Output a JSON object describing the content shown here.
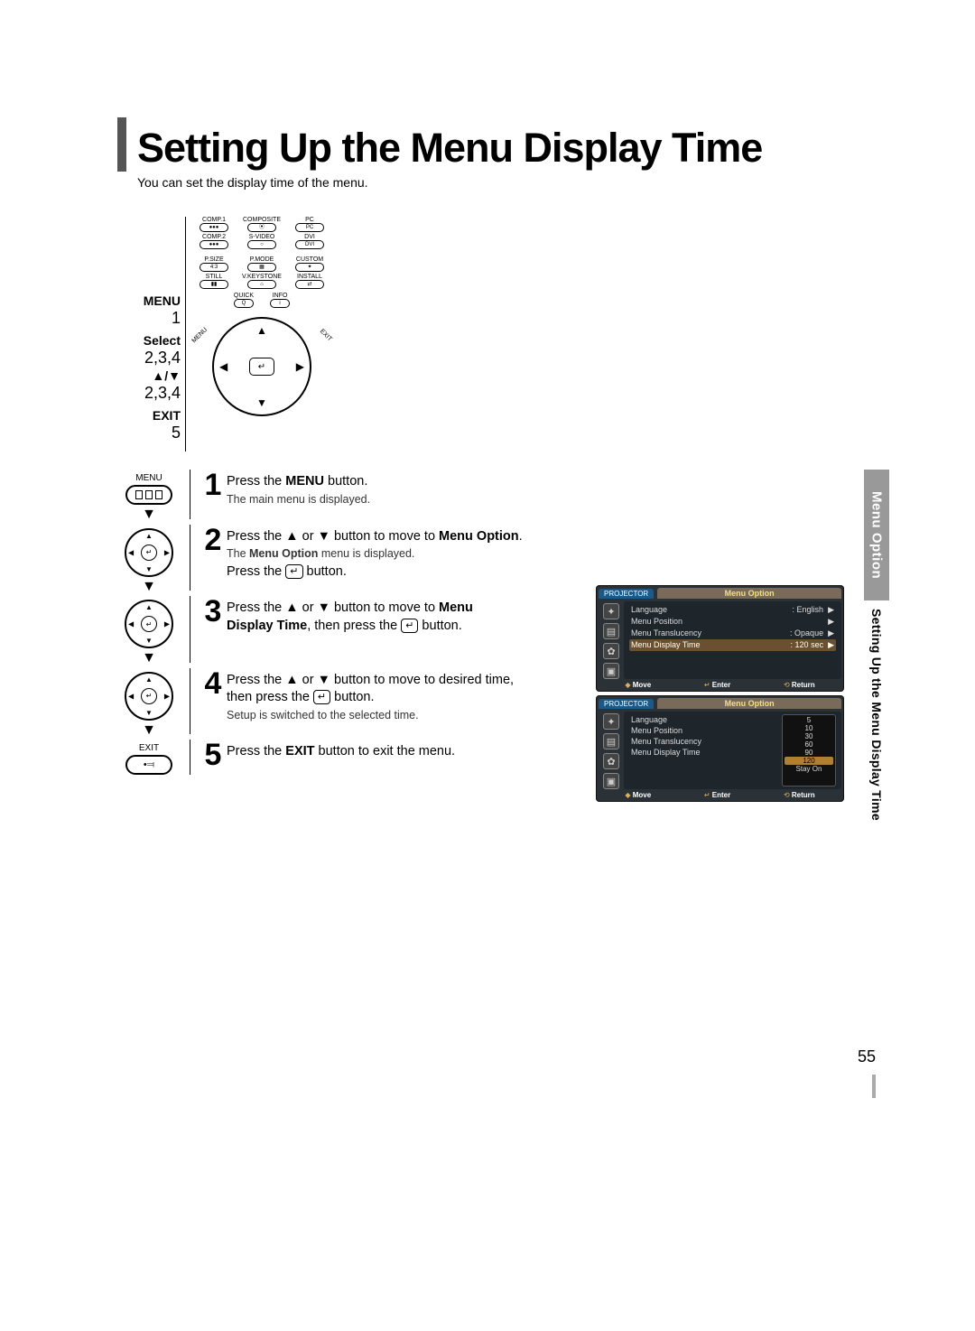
{
  "title": "Setting Up the Menu Display Time",
  "subtitle": "You can set the display time of the menu.",
  "remote": {
    "row1": [
      "COMP.1",
      "COMPOSITE",
      "PC"
    ],
    "row2": [
      "COMP.2",
      "S-VIDEO",
      "DVI"
    ],
    "row3": [
      "P.SIZE",
      "P.MODE",
      "CUSTOM"
    ],
    "row4": [
      "STILL",
      "V.KEYSTONE",
      "INSTALL"
    ],
    "quick": "QUICK",
    "info": "INFO",
    "menu_small": "MENU",
    "exit_small": "EXIT",
    "labels": {
      "menu": "MENU",
      "menu_n": "1",
      "select": "Select",
      "select_n": "2,3,4",
      "ud": "▲/▼",
      "ud_n": "2,3,4",
      "exit": "EXIT",
      "exit_n": "5"
    }
  },
  "steps": {
    "s1": {
      "num": "1",
      "icon_label": "MENU",
      "line1a": "Press the ",
      "line1b": "MENU",
      "line1c": " button.",
      "sub": "The main menu is displayed."
    },
    "s2": {
      "num": "2",
      "line1a": "Press the ▲ or ▼ button to move to ",
      "line1b": "Menu Option",
      "line1c": ".",
      "sub_a": "The ",
      "sub_b": "Menu Option",
      "sub_c": " menu is displayed.",
      "line2a": "Press the ",
      "line2b": "↵",
      "line2c": " button."
    },
    "s3": {
      "num": "3",
      "l1a": "Press the ▲ or ▼ button to move to ",
      "l1b": "Menu",
      "l2a": "Display Time",
      "l2b": ", then press the ",
      "l2c": "↵",
      "l2d": " button."
    },
    "s4": {
      "num": "4",
      "l1": "Press the ▲ or ▼ button to move to desired time,",
      "l2a": "then press the ",
      "l2b": "↵",
      "l2c": " button.",
      "sub": "Setup is switched to the selected time."
    },
    "s5": {
      "num": "5",
      "icon_label": "EXIT",
      "l1a": "Press the ",
      "l1b": "EXIT",
      "l1c": " button to exit the menu."
    }
  },
  "osd1": {
    "projector": "PROJECTOR",
    "title": "Menu Option",
    "rows": [
      {
        "k": "Language",
        "v": ": English",
        "arrow": "▶"
      },
      {
        "k": "Menu Position",
        "v": "",
        "arrow": "▶"
      },
      {
        "k": "Menu Translucency",
        "v": ": Opaque",
        "arrow": "▶"
      },
      {
        "k": "Menu Display Time",
        "v": ": 120 sec",
        "arrow": "▶",
        "sel": true
      }
    ],
    "footer": {
      "move": "Move",
      "enter": "Enter",
      "return": "Return"
    }
  },
  "osd2": {
    "projector": "PROJECTOR",
    "title": "Menu Option",
    "rows": [
      {
        "k": "Language"
      },
      {
        "k": "Menu Position"
      },
      {
        "k": "Menu Translucency"
      },
      {
        "k": "Menu Display Time"
      }
    ],
    "options": [
      "5",
      "10",
      "30",
      "60",
      "90",
      "120",
      "Stay On"
    ],
    "options_sel_index": 5,
    "footer": {
      "move": "Move",
      "enter": "Enter",
      "return": "Return"
    }
  },
  "sidetab": {
    "gray": "Menu Option",
    "black": "Setting Up the Menu Display Time"
  },
  "pagenum": "55"
}
